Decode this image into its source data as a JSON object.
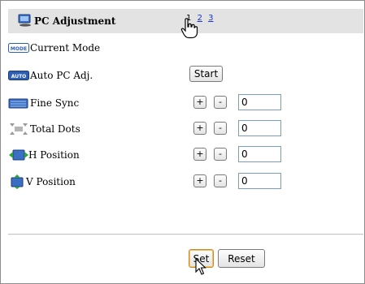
{
  "header": {
    "title": "PC Adjustment",
    "title_icon": "pc-monitor-icon",
    "pages": [
      {
        "label": "1",
        "current": true
      },
      {
        "label": "2",
        "current": false
      },
      {
        "label": "3",
        "current": false
      }
    ]
  },
  "rows": {
    "current_mode": {
      "label": "Current Mode",
      "icon": "mode-icon",
      "icon_text": "MODE"
    },
    "auto_pc": {
      "label": "Auto PC Adj.",
      "icon": "auto-icon",
      "icon_text": "AUTO",
      "button": "Start"
    },
    "fine_sync": {
      "label": "Fine Sync",
      "icon": "fine-sync-icon",
      "plus": "+",
      "minus": "-",
      "value": "0"
    },
    "total_dots": {
      "label": "Total Dots",
      "icon": "total-dots-icon",
      "plus": "+",
      "minus": "-",
      "value": "0"
    },
    "h_position": {
      "label": "H Position",
      "icon": "h-position-icon",
      "plus": "+",
      "minus": "-",
      "value": "0"
    },
    "v_position": {
      "label": "V Position",
      "icon": "v-position-icon",
      "plus": "+",
      "minus": "-",
      "value": "0"
    }
  },
  "footer": {
    "set": "Set",
    "reset": "Reset"
  },
  "colors": {
    "header_bg": "#e3e3e3",
    "link": "#1a33cc",
    "icon_blue": "#2f5fb3"
  }
}
